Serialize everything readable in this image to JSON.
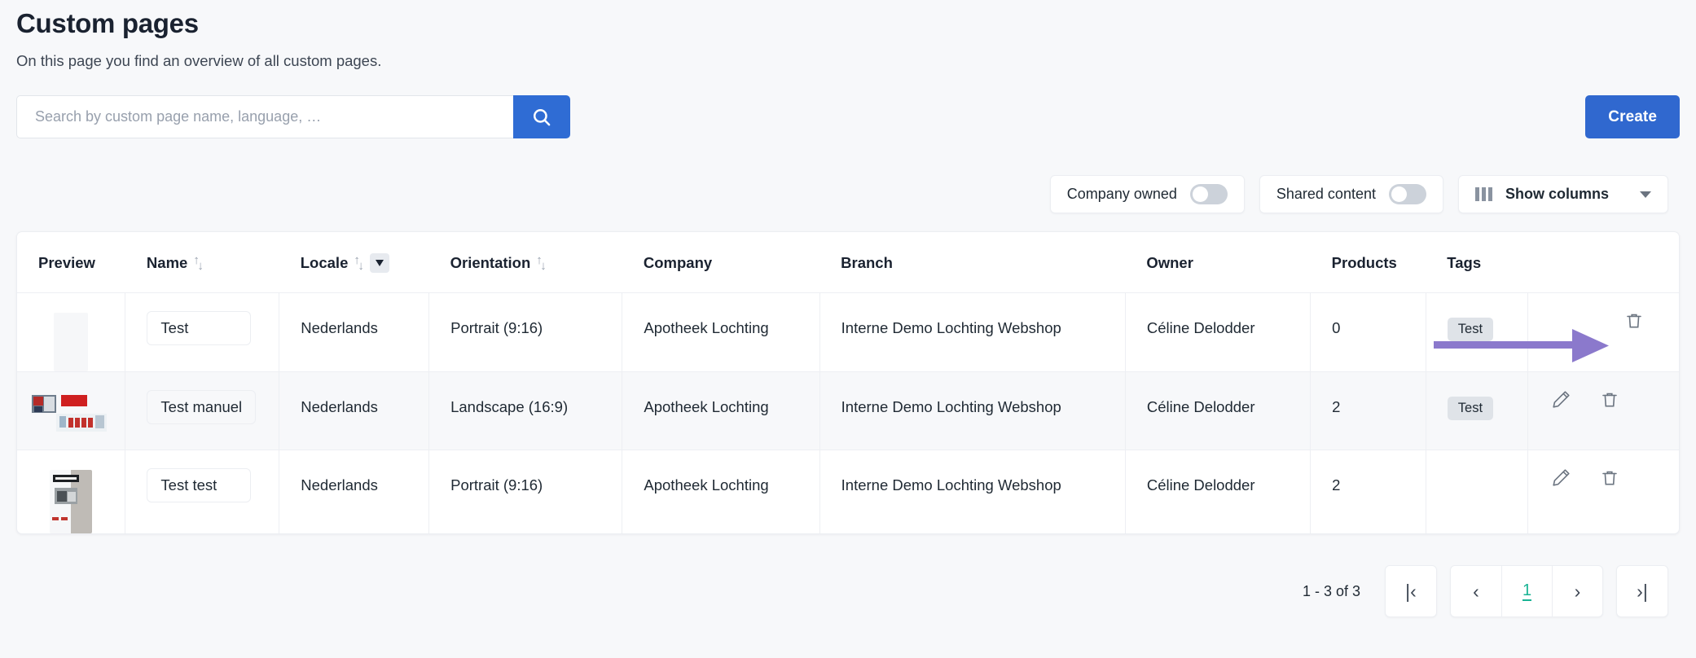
{
  "header": {
    "title": "Custom pages",
    "subtitle": "On this page you find an overview of all custom pages."
  },
  "search": {
    "placeholder": "Search by custom page name, language, …",
    "value": "",
    "button_icon": "search-icon"
  },
  "create_button": {
    "label": "Create"
  },
  "toolbar": {
    "company_owned": {
      "label": "Company owned",
      "enabled": false
    },
    "shared_content": {
      "label": "Shared content",
      "enabled": false
    },
    "show_columns": {
      "label": "Show columns",
      "icon": "columns-icon",
      "chevron": "chevron-down-icon"
    }
  },
  "table": {
    "columns": [
      {
        "label": "Preview",
        "sortable": false,
        "filterable": false
      },
      {
        "label": "Name",
        "sortable": true,
        "filterable": false
      },
      {
        "label": "Locale",
        "sortable": true,
        "filterable": true
      },
      {
        "label": "Orientation",
        "sortable": true,
        "filterable": false
      },
      {
        "label": "Company",
        "sortable": false,
        "filterable": false
      },
      {
        "label": "Branch",
        "sortable": false,
        "filterable": false
      },
      {
        "label": "Owner",
        "sortable": false,
        "filterable": false
      },
      {
        "label": "Products",
        "sortable": false,
        "filterable": false
      },
      {
        "label": "Tags",
        "sortable": false,
        "filterable": false
      },
      {
        "label": "",
        "sortable": false,
        "filterable": false
      }
    ],
    "rows": [
      {
        "name": "Test",
        "locale": "Nederlands",
        "orientation": "Portrait (9:16)",
        "company": "Apotheek Lochting",
        "branch": "Interne Demo Lochting Webshop",
        "owner": "Céline Delodder",
        "products": "0",
        "tags": [
          "Test"
        ],
        "preview_kind": "portrait-blank",
        "has_edit": false,
        "has_delete": true,
        "hovered": false
      },
      {
        "name": "Test manuel",
        "locale": "Nederlands",
        "orientation": "Landscape (16:9)",
        "company": "Apotheek Lochting",
        "branch": "Interne Demo Lochting Webshop",
        "owner": "Céline Delodder",
        "products": "2",
        "tags": [
          "Test"
        ],
        "preview_kind": "landscape-content",
        "has_edit": true,
        "has_delete": true,
        "hovered": true
      },
      {
        "name": "Test test",
        "locale": "Nederlands",
        "orientation": "Portrait (9:16)",
        "company": "Apotheek Lochting",
        "branch": "Interne Demo Lochting Webshop",
        "owner": "Céline Delodder",
        "products": "2",
        "tags": [],
        "preview_kind": "portrait-content",
        "has_edit": true,
        "has_delete": true,
        "hovered": false
      }
    ]
  },
  "pagination": {
    "range": "1 - 3 of 3",
    "first_label": "|‹",
    "prev_label": "‹",
    "current_page": "1",
    "next_label": "›",
    "last_label": "›|"
  },
  "annotation": {
    "type": "arrow",
    "color": "#8b79cc",
    "direction": "right"
  },
  "colors": {
    "accent_blue": "#3068cf",
    "search_blue": "#2f6cd4",
    "page_current_teal": "#19b394",
    "annotation_purple": "#8b79cc",
    "background": "#f7f8fa"
  }
}
